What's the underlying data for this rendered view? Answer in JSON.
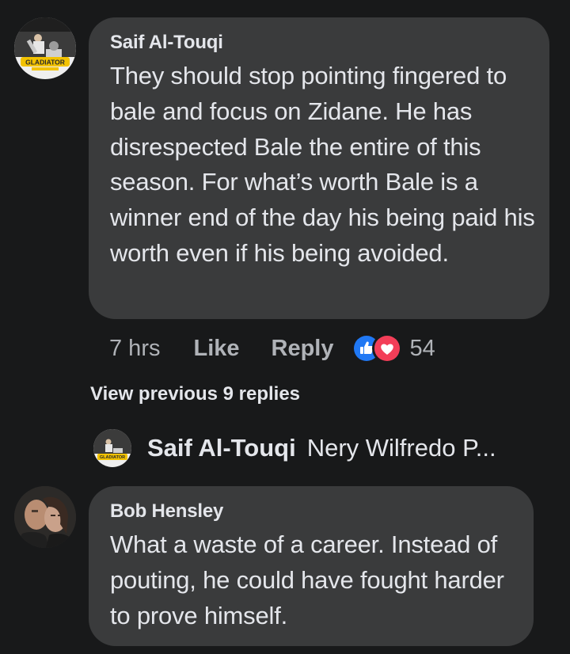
{
  "comments": [
    {
      "author": "Saif Al-Touqi",
      "avatar_caption": "GLADIATOR",
      "text": "They should stop pointing fingered to bale and focus on Zidane. He has disrespected Bale the entire of this season. For what’s worth Bale is a winner end of the day his being paid his worth even if his being avoided.",
      "time": "7 hrs",
      "like_label": "Like",
      "reply_label": "Reply",
      "reaction_count": "54",
      "reaction_icons": [
        "like-icon",
        "love-icon"
      ],
      "view_previous": "View previous 9 replies",
      "latest_reply": {
        "author": "Saif Al-Touqi",
        "snippet": "Nery Wilfredo P..."
      }
    },
    {
      "author": "Bob Hensley",
      "text": "What a waste of a career. Instead of pouting, he could have fought harder to prove himself."
    }
  ],
  "colors": {
    "background": "#18191a",
    "bubble": "#3a3b3c",
    "text_primary": "#e4e6eb",
    "text_secondary": "#b0b3b8",
    "like_blue": "#2078f4",
    "love_red": "#f33e58"
  }
}
